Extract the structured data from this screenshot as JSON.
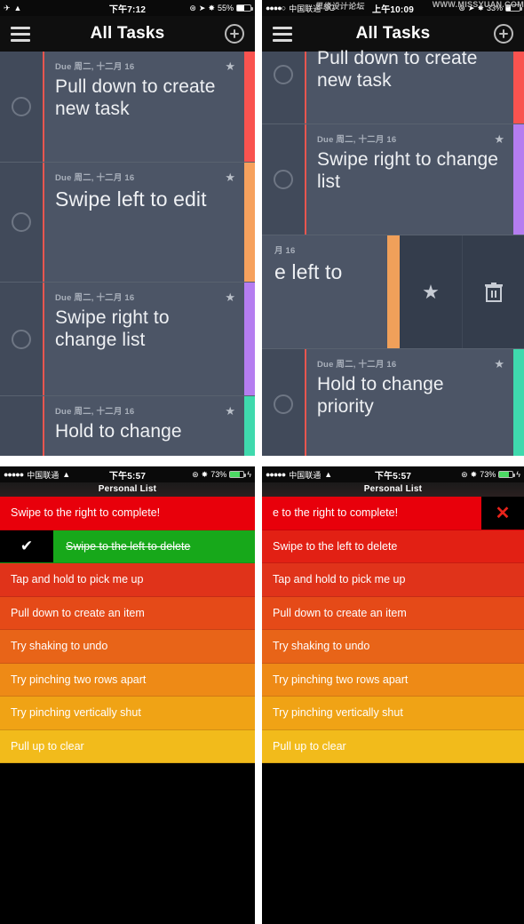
{
  "watermark": {
    "cn": "思缘设计论坛",
    "url": "WWW.MISSYUAN.COM"
  },
  "panels": {
    "top_left": {
      "status": {
        "airplane_icon": "airplane-icon",
        "wifi_icon": "wifi-icon",
        "time": "下午7:12",
        "lock_rotation_icon": "rotation-lock-icon",
        "location_icon": "location-arrow-icon",
        "bluetooth_icon": "bluetooth-icon",
        "battery_percent": "55%"
      },
      "nav": {
        "menu_icon": "hamburger-menu-icon",
        "title": "All Tasks",
        "add_icon": "plus-circle-icon"
      },
      "tasks": [
        {
          "due": "Due 周二, 十二月 16",
          "title": "Pull down to create new task",
          "star_icon": "star-icon",
          "checkbox_icon": "checkbox-circle-icon",
          "priority_color": "#f9534f"
        },
        {
          "due": "Due 周二, 十二月 16",
          "title": "Swipe left to edit",
          "star_icon": "star-icon",
          "checkbox_icon": "checkbox-circle-icon",
          "priority_color": "#f6a15d"
        },
        {
          "due": "Due 周二, 十二月 16",
          "title": "Swipe right to change list",
          "star_icon": "star-icon",
          "checkbox_icon": "checkbox-circle-icon",
          "priority_color": "#b57df0"
        },
        {
          "due": "Due 周二, 十二月 16",
          "title": "Hold to change",
          "star_icon": "star-icon",
          "checkbox_icon": "checkbox-circle-icon",
          "priority_color": "#3fd9ad"
        }
      ]
    },
    "top_right": {
      "status": {
        "signal_dots": "●●●●○",
        "carrier": "中国联通",
        "network": "3G",
        "time": "上午10:09",
        "lock_rotation_icon": "rotation-lock-icon",
        "location_icon": "location-arrow-icon",
        "bluetooth_icon": "bluetooth-icon",
        "battery_percent": "33%"
      },
      "nav": {
        "menu_icon": "hamburger-menu-icon",
        "title": "All Tasks",
        "add_icon": "plus-circle-icon"
      },
      "tasks": [
        {
          "due": "",
          "title": "Pull down to create new task",
          "star_icon": "",
          "checkbox_icon": "checkbox-circle-icon",
          "priority_color": "#f9534f"
        },
        {
          "due": "Due 周二, 十二月 16",
          "title": "Swipe right to change list",
          "star_icon": "star-icon",
          "checkbox_icon": "checkbox-circle-icon",
          "priority_color": "#b57df0"
        },
        {
          "due": "月 16",
          "title": "e left to",
          "star_icon": "star-icon",
          "checkbox_icon": "",
          "priority_color": "",
          "swiped": true,
          "actions": [
            {
              "icon": "star-icon",
              "glyph": "★",
              "name": "favorite-action"
            },
            {
              "icon": "trash-icon",
              "glyph": "🗑",
              "name": "delete-action"
            }
          ]
        },
        {
          "due": "Due 周二, 十二月 16",
          "title": "Hold to change priority",
          "star_icon": "star-icon",
          "checkbox_icon": "checkbox-circle-icon",
          "priority_color": "#3fd9ad"
        }
      ]
    },
    "bottom_left": {
      "status": {
        "signal_dots": "●●●●●",
        "carrier": "中国联通",
        "wifi_icon": "wifi-icon",
        "time": "下午5:57",
        "lock_rotation_icon": "rotation-lock-icon",
        "bluetooth_icon": "bluetooth-icon",
        "battery_percent": "73%",
        "charging_icon": "charging-bolt-icon"
      },
      "nav": {
        "title": "Personal List"
      },
      "items": [
        {
          "text": "Swipe to the right to complete!",
          "color": "#e8000b",
          "state": "normal"
        },
        {
          "text": "Swipe to the left to delete",
          "color": "#17a81a",
          "state": "completed",
          "check_icon": "checkmark-icon"
        },
        {
          "text": "Tap and hold to pick me up",
          "color": "#e0331a",
          "state": "normal"
        },
        {
          "text": "Pull down to create an item",
          "color": "#e54a18",
          "state": "normal"
        },
        {
          "text": "Try shaking to undo",
          "color": "#e86418",
          "state": "normal"
        },
        {
          "text": "Try pinching two rows apart",
          "color": "#ee8a16",
          "state": "normal"
        },
        {
          "text": "Try pinching vertically shut",
          "color": "#f0a315",
          "state": "normal"
        },
        {
          "text": "Pull up to clear",
          "color": "#f2bb1b",
          "state": "normal"
        }
      ]
    },
    "bottom_right": {
      "status": {
        "signal_dots": "●●●●●",
        "carrier": "中国联通",
        "wifi_icon": "wifi-icon",
        "time": "下午5:57",
        "lock_rotation_icon": "rotation-lock-icon",
        "bluetooth_icon": "bluetooth-icon",
        "battery_percent": "73%",
        "charging_icon": "charging-bolt-icon"
      },
      "nav": {
        "title": "Personal List"
      },
      "items": [
        {
          "text": "e to the right to complete!",
          "color": "#e8000b",
          "state": "swiped",
          "delete_icon": "close-x-icon",
          "delete_glyph": "✕"
        },
        {
          "text": "Swipe to the left to delete",
          "color": "#e22014",
          "state": "normal"
        },
        {
          "text": "Tap and hold to pick me up",
          "color": "#e0331a",
          "state": "normal"
        },
        {
          "text": "Pull down to create an item",
          "color": "#e54a18",
          "state": "normal"
        },
        {
          "text": "Try shaking to undo",
          "color": "#e86418",
          "state": "normal"
        },
        {
          "text": "Try pinching two rows apart",
          "color": "#ee8a16",
          "state": "normal"
        },
        {
          "text": "Try pinching vertically shut",
          "color": "#f0a315",
          "state": "normal"
        },
        {
          "text": "Pull up to clear",
          "color": "#f2bb1b",
          "state": "normal"
        }
      ]
    }
  }
}
